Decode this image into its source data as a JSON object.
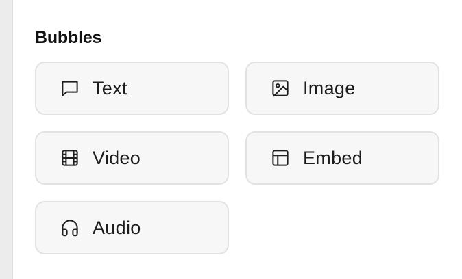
{
  "section": {
    "title": "Bubbles"
  },
  "bubbles": [
    {
      "label": "Text",
      "icon": "message-square-icon"
    },
    {
      "label": "Image",
      "icon": "image-icon"
    },
    {
      "label": "Video",
      "icon": "film-icon"
    },
    {
      "label": "Embed",
      "icon": "layout-icon"
    },
    {
      "label": "Audio",
      "icon": "headphones-icon"
    }
  ]
}
